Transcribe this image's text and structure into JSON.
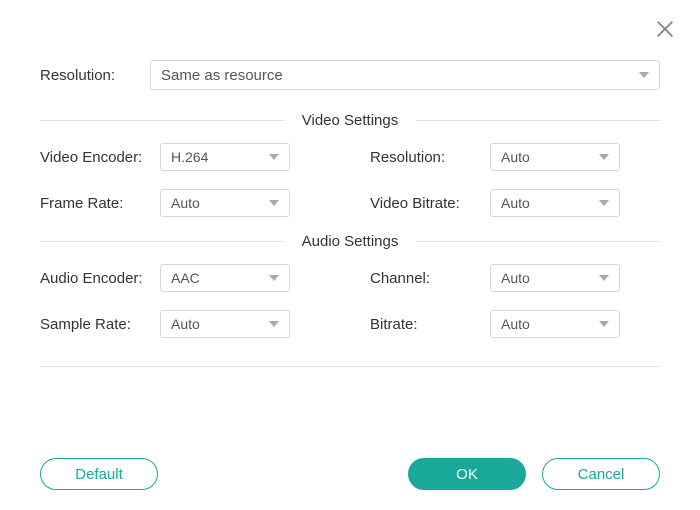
{
  "close_icon": "close-icon",
  "top": {
    "resolution_label": "Resolution:",
    "resolution_value": "Same as resource"
  },
  "video": {
    "section_title": "Video Settings",
    "encoder_label": "Video Encoder:",
    "encoder_value": "H.264",
    "resolution_label": "Resolution:",
    "resolution_value": "Auto",
    "frame_rate_label": "Frame Rate:",
    "frame_rate_value": "Auto",
    "bitrate_label": "Video Bitrate:",
    "bitrate_value": "Auto"
  },
  "audio": {
    "section_title": "Audio Settings",
    "encoder_label": "Audio Encoder:",
    "encoder_value": "AAC",
    "channel_label": "Channel:",
    "channel_value": "Auto",
    "sample_rate_label": "Sample Rate:",
    "sample_rate_value": "Auto",
    "bitrate_label": "Bitrate:",
    "bitrate_value": "Auto"
  },
  "footer": {
    "default_label": "Default",
    "ok_label": "OK",
    "cancel_label": "Cancel"
  }
}
